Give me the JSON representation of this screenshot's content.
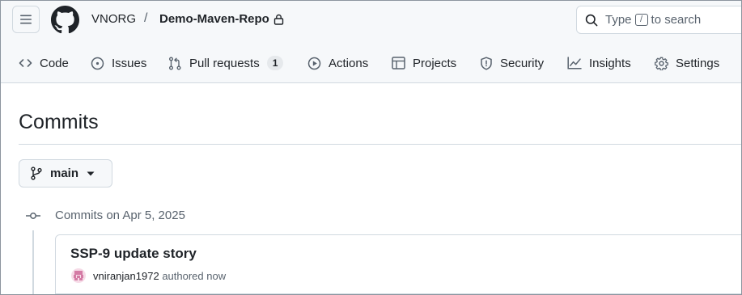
{
  "breadcrumb": {
    "owner": "VNORG",
    "separator": "/",
    "repo": "Demo-Maven-Repo"
  },
  "search": {
    "prefix": "Type",
    "key": "/",
    "suffix": "to search"
  },
  "tabs": [
    {
      "label": "Code",
      "icon": "code-icon"
    },
    {
      "label": "Issues",
      "icon": "issue-icon"
    },
    {
      "label": "Pull requests",
      "icon": "pull-request-icon",
      "count": "1"
    },
    {
      "label": "Actions",
      "icon": "play-icon"
    },
    {
      "label": "Projects",
      "icon": "table-icon"
    },
    {
      "label": "Security",
      "icon": "shield-icon"
    },
    {
      "label": "Insights",
      "icon": "graph-icon"
    },
    {
      "label": "Settings",
      "icon": "gear-icon"
    }
  ],
  "page": {
    "title": "Commits"
  },
  "branch": {
    "name": "main"
  },
  "commit_groups": [
    {
      "label": "Commits on Apr 5, 2025",
      "commits": [
        {
          "title": "SSP-9 update story",
          "author": "vniranjan1972",
          "action": "authored",
          "time": "now"
        }
      ]
    }
  ],
  "colors": {
    "text": "#1f2328",
    "muted": "#59636e",
    "border": "#d1d9e0",
    "header_bg": "#f6f8fa",
    "avatar_bg": "#f6dbe7"
  }
}
